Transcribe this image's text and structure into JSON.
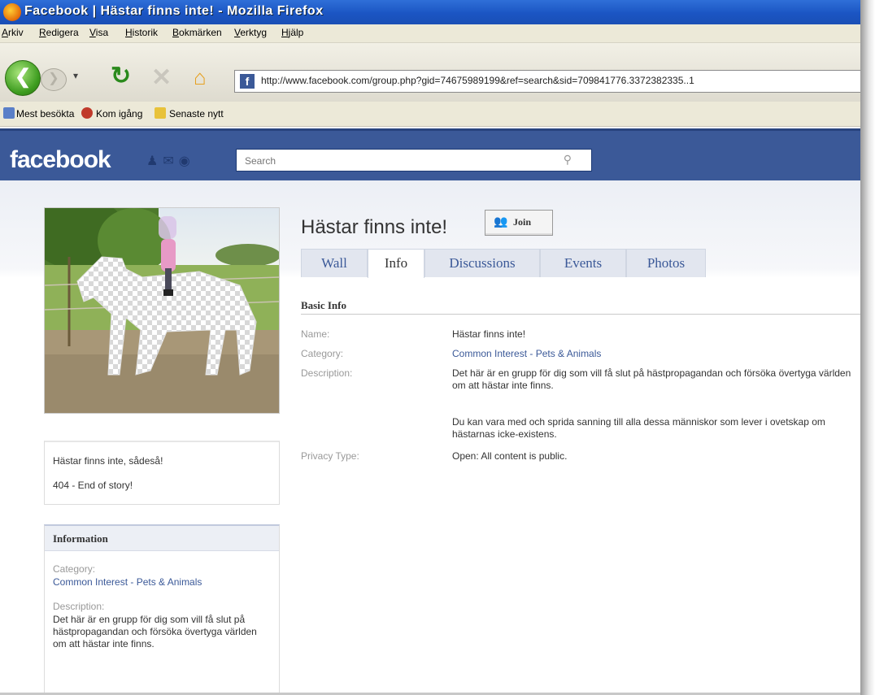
{
  "window": {
    "title": "Facebook | Hästar finns inte! - Mozilla Firefox"
  },
  "menu": [
    "Arkiv",
    "Redigera",
    "Visa",
    "Historik",
    "Bokmärken",
    "Verktyg",
    "Hjälp"
  ],
  "nav": {
    "url": "http://www.facebook.com/group.php?gid=74675989199&ref=search&sid=709841776.3372382335..1"
  },
  "bookmarks": [
    "Mest besökta",
    "Kom igång",
    "Senaste nytt"
  ],
  "fb": {
    "logo": "facebook",
    "search_placeholder": "Search"
  },
  "group": {
    "title": "Hästar finns inte!",
    "join_label": "Join",
    "tabs": [
      "Wall",
      "Info",
      "Discussions",
      "Events",
      "Photos"
    ],
    "active_tab": "Info"
  },
  "basic_info": {
    "heading": "Basic Info",
    "rows": [
      {
        "label": "Name:",
        "value": "Hästar finns inte!"
      },
      {
        "label": "Category:",
        "value": "Common Interest - Pets & Animals"
      },
      {
        "label": "Description:",
        "value": "Det här är en grupp för dig som vill få slut på hästpropagandan och försöka övertyga världen om att hästar inte finns.",
        "value2": "Du kan vara med och sprida sanning till alla dessa människor som lever i ovetskap om hästarnas icke-existens."
      },
      {
        "label": "Privacy Type:",
        "value": "Open: All content is public."
      }
    ]
  },
  "left_box": {
    "line1": "Hästar finns inte, sådeså!",
    "line2": "404 - End of story!"
  },
  "information": {
    "heading": "Information",
    "category_label": "Category:",
    "category_value": "Common Interest - Pets & Animals",
    "description_label": "Description:",
    "description_value": "Det här är en grupp för dig som vill få slut på hästpropagandan och försöka övertyga världen om att hästar inte finns."
  },
  "colors": {
    "facebook_blue": "#3b5998",
    "link": "#3b5998",
    "titlebar": "#1b55c3"
  }
}
